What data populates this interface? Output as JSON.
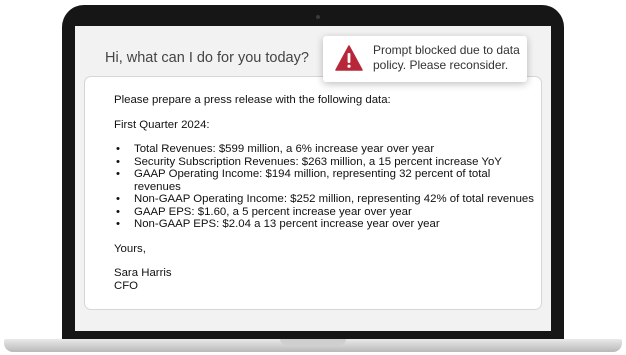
{
  "chat": {
    "greeting": "Hi, what can I do for you today?"
  },
  "alert": {
    "icon": "warning-triangle-icon",
    "icon_color": "#b8263a",
    "text": "Prompt blocked due to data policy. Please reconsider."
  },
  "message": {
    "intro": "Please prepare a press release with the following data:",
    "period": "First Quarter 2024:",
    "items": [
      "Total Revenues: $599 million, a 6% increase year over year",
      "Security Subscription Revenues: $263 million, a 15 percent increase YoY",
      "GAAP Operating Income: $194 million, representing 32 percent of total revenues",
      "Non-GAAP Operating Income: $252 million, representing 42% of total revenues",
      "GAAP EPS: $1.60, a 5 percent increase year over year",
      "Non-GAAP EPS: $2.04 a 13 percent increase year over year"
    ],
    "closing": "Yours,",
    "name": "Sara Harris",
    "title": "CFO"
  }
}
